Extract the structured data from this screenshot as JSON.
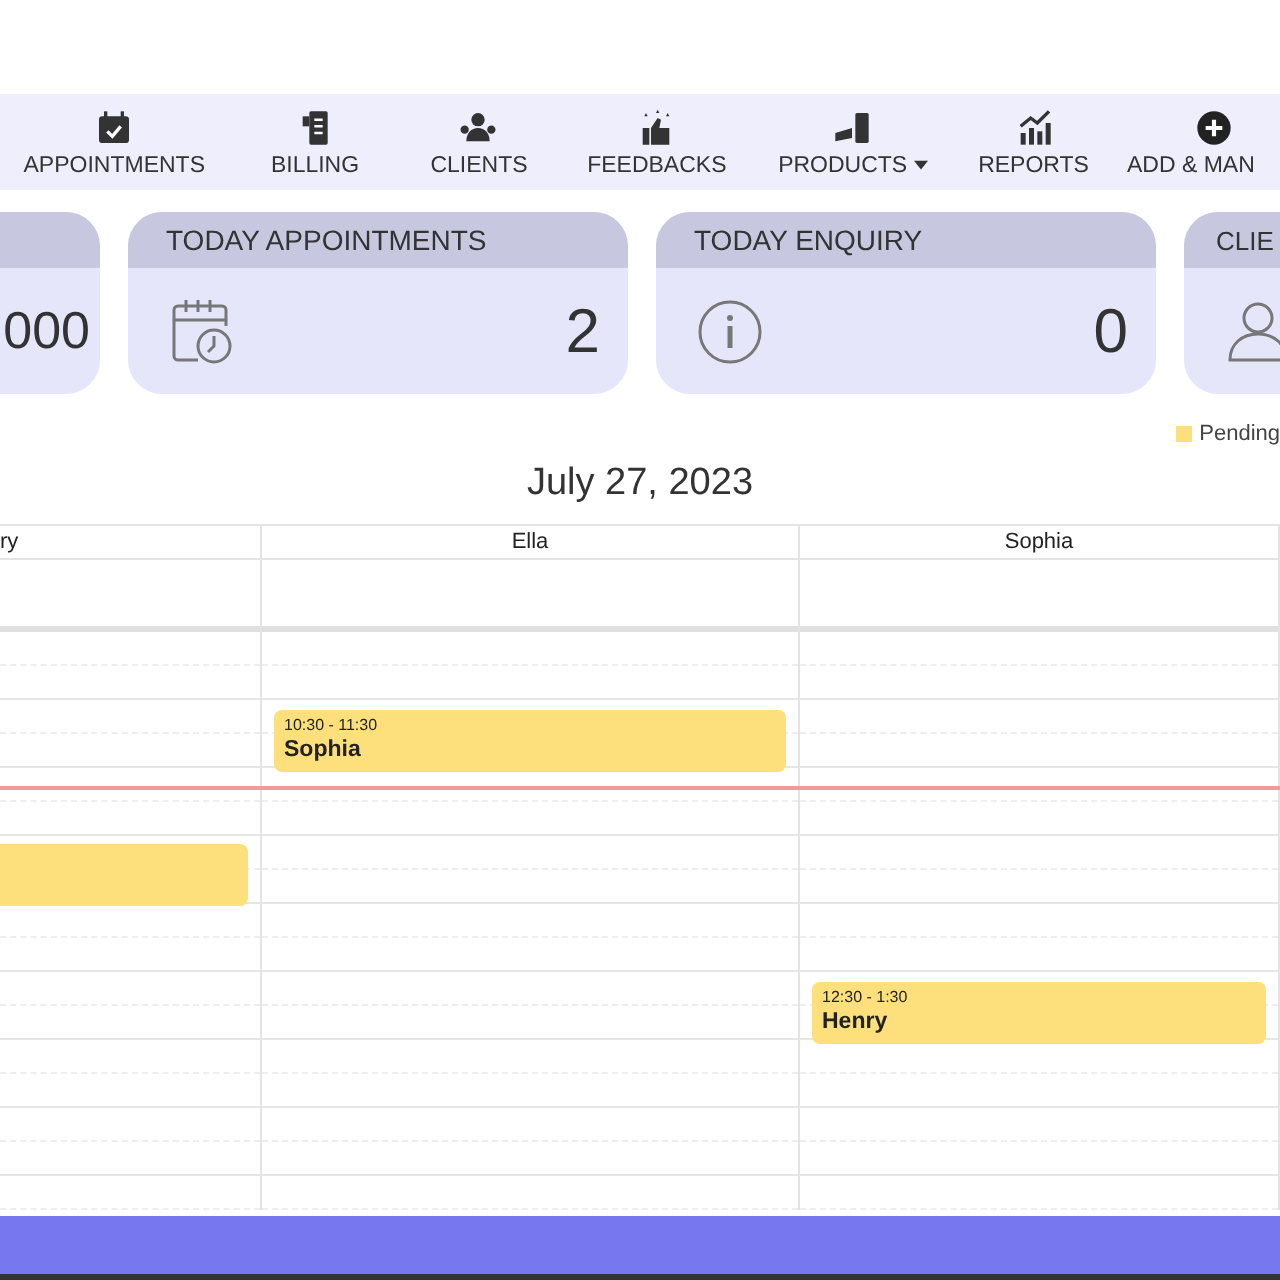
{
  "nav": [
    {
      "label": "APPOINTMENTS",
      "kind": "calendar",
      "dropdown": false
    },
    {
      "label": "BILLING",
      "kind": "receipt",
      "dropdown": false
    },
    {
      "label": "CLIENTS",
      "kind": "people",
      "dropdown": false
    },
    {
      "label": "FEEDBACKS",
      "kind": "thumb",
      "dropdown": false
    },
    {
      "label": "PRODUCTS",
      "kind": "products",
      "dropdown": true
    },
    {
      "label": "REPORTS",
      "kind": "chart",
      "dropdown": false
    },
    {
      "label": "ADD & MAN",
      "kind": "plus",
      "dropdown": false
    }
  ],
  "cards": [
    {
      "value": "000",
      "kind": "none"
    },
    {
      "title": "TODAY APPOINTMENTS",
      "value": "2",
      "kind": "calendar-clock"
    },
    {
      "title": "TODAY ENQUIRY",
      "value": "0",
      "kind": "info"
    },
    {
      "title": "CLIE",
      "kind": "person"
    }
  ],
  "legend": [
    {
      "label": "Pending",
      "color": "#fde07c"
    }
  ],
  "date": "July 27, 2023",
  "columns": [
    {
      "name": "ry",
      "events": [
        {
          "color": "#fde07c"
        }
      ]
    },
    {
      "name": "Ella",
      "events": [
        {
          "time": "10:30 - 11:30",
          "client": "Sophia",
          "color": "#fde07c"
        }
      ]
    },
    {
      "name": "Sophia",
      "events": [
        {
          "time": "12:30 - 1:30",
          "client": "Henry",
          "color": "#fde07c"
        }
      ]
    }
  ]
}
